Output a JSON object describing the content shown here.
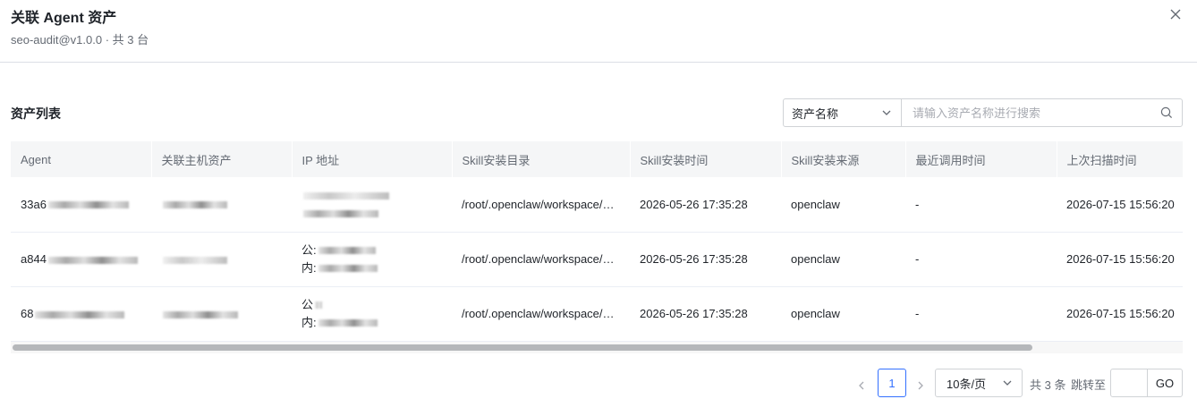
{
  "modal": {
    "title": "关联 Agent 资产",
    "subtitle": "seo-audit@v1.0.0 · 共 3 台"
  },
  "section": {
    "title": "资产列表"
  },
  "search": {
    "field": "资产名称",
    "placeholder": "请输入资产名称进行搜索"
  },
  "table": {
    "columns": [
      "Agent",
      "关联主机资产",
      "IP 地址",
      "Skill安装目录",
      "Skill安装时间",
      "Skill安装来源",
      "最近调用时间",
      "上次扫描时间"
    ],
    "rows": [
      {
        "agent": "33a6",
        "host": "",
        "ip_line1": "",
        "ip_line2": "",
        "dir": "/root/.openclaw/workspace/sk...",
        "install_time": "2026-05-26 17:35:28",
        "source": "openclaw",
        "last_call": "-",
        "last_scan": "2026-07-15 15:56:20"
      },
      {
        "agent": "a844",
        "host": "",
        "ip_line1": "公:",
        "ip_line2": "内:",
        "dir": "/root/.openclaw/workspace/sk...",
        "install_time": "2026-05-26 17:35:28",
        "source": "openclaw",
        "last_call": "-",
        "last_scan": "2026-07-15 15:56:20"
      },
      {
        "agent": "68",
        "host": "",
        "ip_line1": "公",
        "ip_line2": "内:",
        "dir": "/root/.openclaw/workspace/sk...",
        "install_time": "2026-05-26 17:35:28",
        "source": "openclaw",
        "last_call": "-",
        "last_scan": "2026-07-15 15:56:20"
      }
    ]
  },
  "pagination": {
    "current_page": "1",
    "page_size": "10条/页",
    "total": "共 3 条",
    "jump_label": "跳转至",
    "go_label": "GO"
  },
  "colors": {
    "accent": "#3370ff",
    "header_bg": "#f5f6f7",
    "border": "#dcdfe6"
  }
}
